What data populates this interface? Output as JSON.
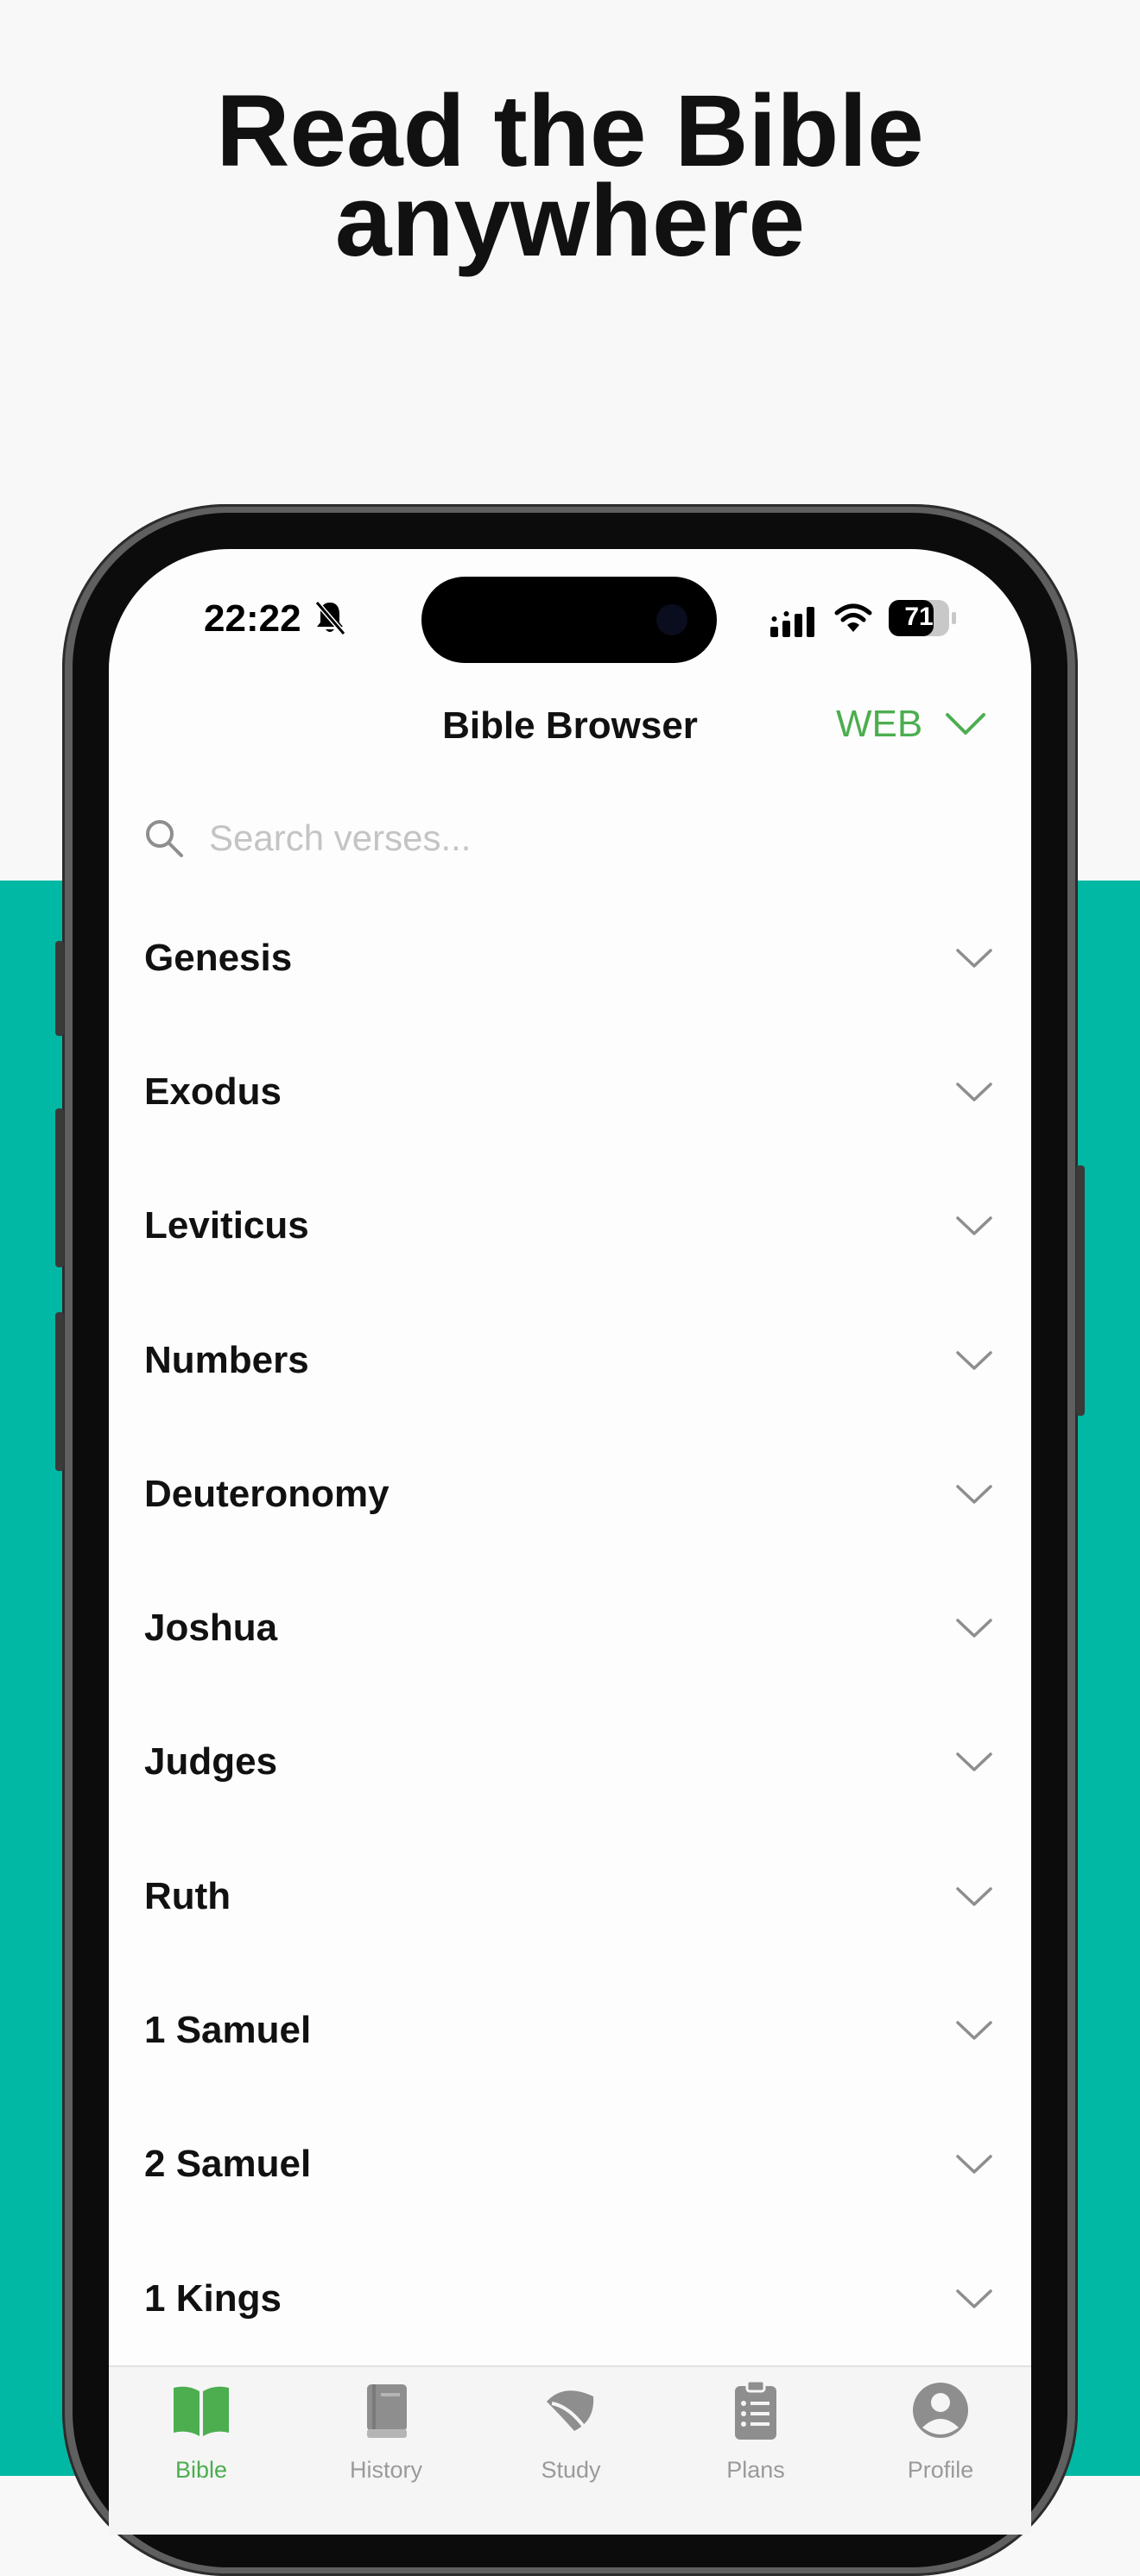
{
  "headline": {
    "line1": "Read the Bible",
    "line2": "anywhere"
  },
  "status_bar": {
    "time": "22:22",
    "battery": "71"
  },
  "header": {
    "title": "Bible Browser",
    "version_label": "WEB"
  },
  "search": {
    "placeholder": "Search verses..."
  },
  "books": [
    "Genesis",
    "Exodus",
    "Leviticus",
    "Numbers",
    "Deuteronomy",
    "Joshua",
    "Judges",
    "Ruth",
    "1 Samuel",
    "2 Samuel",
    "1 Kings"
  ],
  "tabs": [
    {
      "label": "Bible",
      "icon": "open-book-icon",
      "active": true
    },
    {
      "label": "History",
      "icon": "closed-book-icon",
      "active": false
    },
    {
      "label": "Study",
      "icon": "leaf-icon",
      "active": false
    },
    {
      "label": "Plans",
      "icon": "clipboard-icon",
      "active": false
    },
    {
      "label": "Profile",
      "icon": "person-circle-icon",
      "active": false
    }
  ],
  "colors": {
    "accent_green": "#4cae4f",
    "teal_background": "#00b8a3",
    "inactive_gray": "#9a9a9a"
  }
}
